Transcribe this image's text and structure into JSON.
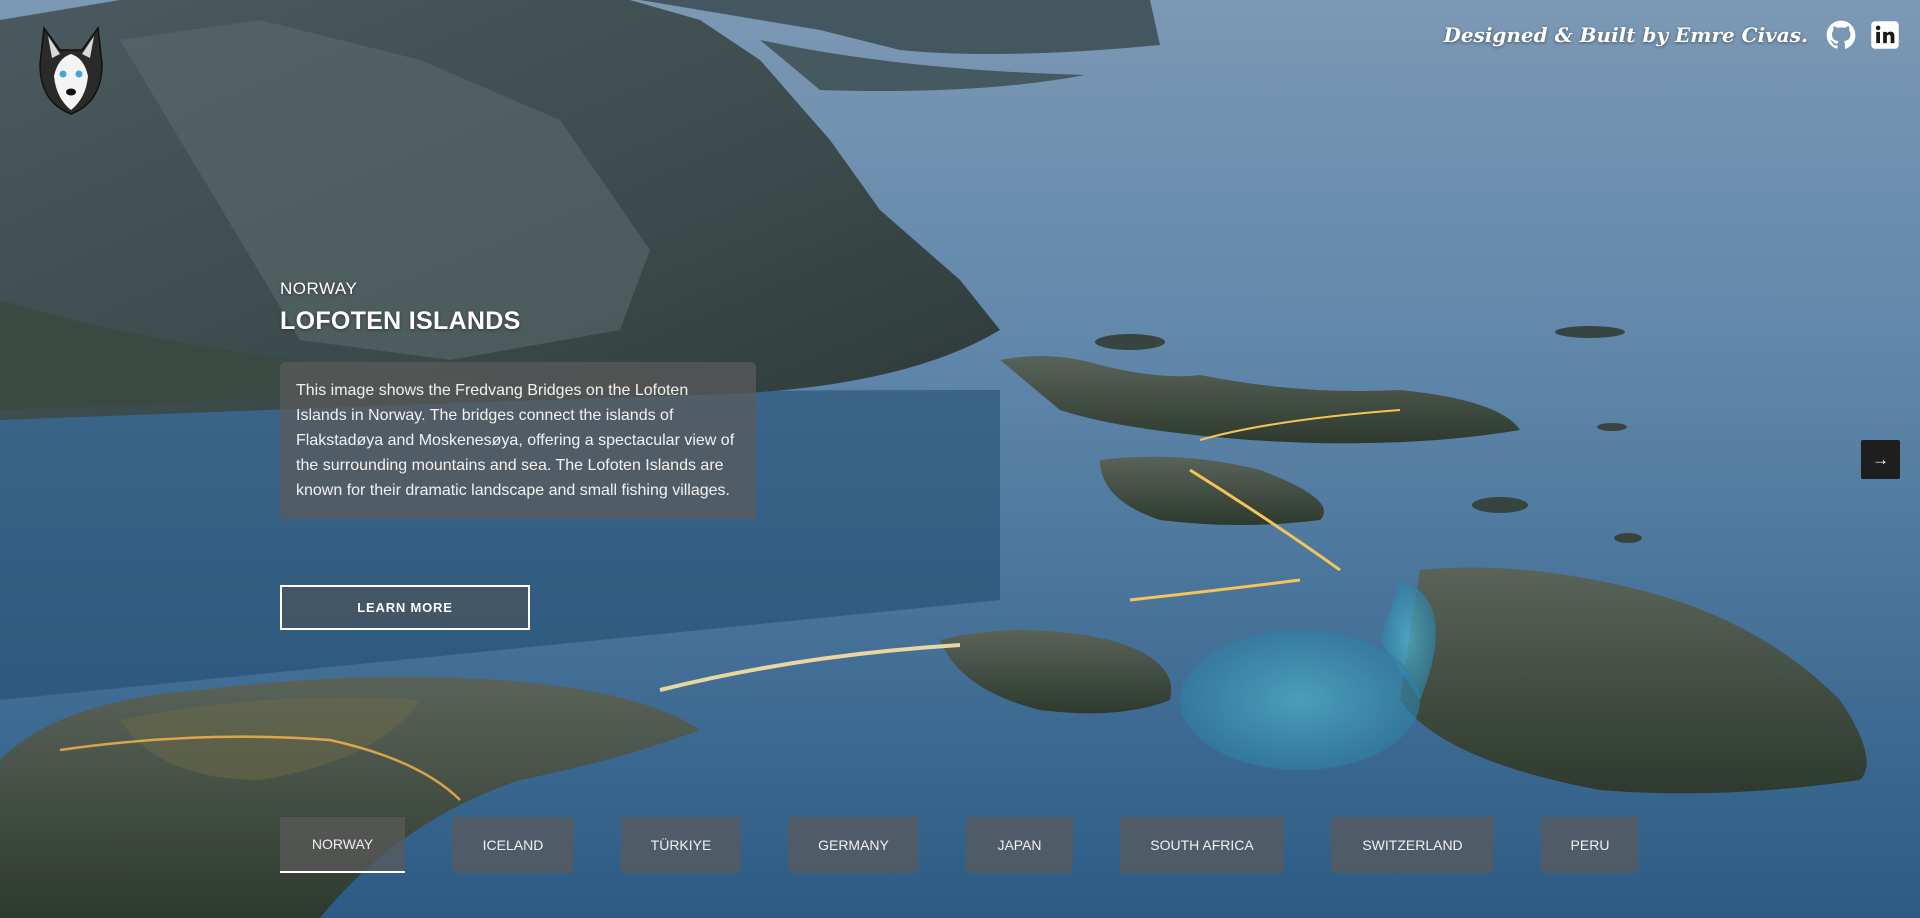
{
  "header": {
    "credit": "Designed & Built by Emre Civas.",
    "icons": [
      "github-icon",
      "linkedin-icon"
    ],
    "logo": "husky-logo"
  },
  "slide": {
    "country": "NORWAY",
    "title": "LOFOTEN ISLANDS",
    "description": "This image shows the Fredvang Bridges on the Lofoten Islands in Norway. The bridges connect the islands of Flakstadøya and Moskenesøya, offering a spectacular view of the surrounding mountains and sea. The Lofoten Islands are known for their dramatic landscape and small fishing villages.",
    "cta_label": "LEARN MORE",
    "next_icon": "arrow-right-icon"
  },
  "tabs": [
    {
      "label": "NORWAY",
      "active": true
    },
    {
      "label": "ICELAND",
      "active": false
    },
    {
      "label": "TÜRKIYE",
      "active": false
    },
    {
      "label": "GERMANY",
      "active": false
    },
    {
      "label": "JAPAN",
      "active": false
    },
    {
      "label": "SOUTH AFRICA",
      "active": false
    },
    {
      "label": "SWITZERLAND",
      "active": false
    },
    {
      "label": "PERU",
      "active": false
    }
  ]
}
